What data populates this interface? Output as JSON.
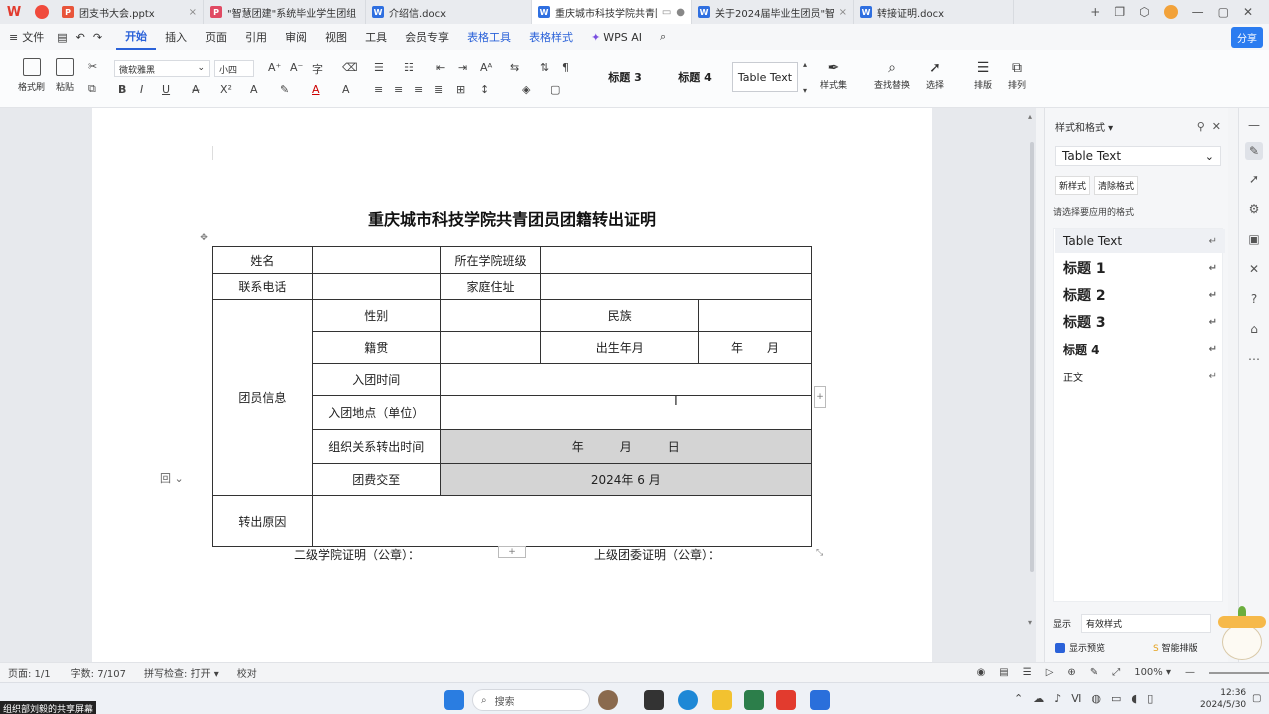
{
  "tabbar": {
    "tabs": [
      {
        "label": "团支书大会.pptx",
        "type": "P",
        "active": false
      },
      {
        "label": "\"智慧团建\"系统毕业学生团组",
        "type": "R",
        "active": false
      },
      {
        "label": "介绍信.docx",
        "type": "W",
        "active": false
      },
      {
        "label": "重庆城市科技学院共青团",
        "type": "W",
        "active": true
      },
      {
        "label": "关于2024届毕业生团员\"智",
        "type": "W",
        "active": false
      },
      {
        "label": "转接证明.docx",
        "type": "W",
        "active": false
      }
    ],
    "new_tab": "+"
  },
  "menubar": {
    "items": [
      "文件",
      "开始",
      "插入",
      "页面",
      "引用",
      "审阅",
      "视图",
      "工具",
      "会员专享",
      "表格工具",
      "表格样式",
      "WPS AI"
    ],
    "active": "开始",
    "share": "分享"
  },
  "ribbon": {
    "format_painter": "格式刷",
    "paste": "粘贴",
    "font_name": "微软雅黑",
    "font_size": "小四",
    "styles": [
      "标题 3",
      "标题 4",
      "Table Text"
    ],
    "style_set": "样式集",
    "find_replace": "查找替换",
    "select": "选择",
    "typeset": "排版",
    "arrange": "排列"
  },
  "document": {
    "title": "重庆城市科技学院共青团员团籍转出证明",
    "table": {
      "r1": [
        "姓名",
        "",
        "所在学院班级",
        ""
      ],
      "r2": [
        "联系电话",
        "",
        "家庭住址",
        ""
      ],
      "group_label": "团员信息",
      "r3": [
        "性别",
        "",
        "民族",
        ""
      ],
      "r4": [
        "籍贯",
        "",
        "出生年月",
        "年　　月"
      ],
      "r5": [
        "入团时间",
        ""
      ],
      "r6": [
        "入团地点（单位）",
        ""
      ],
      "r7": [
        "组织关系转出时间",
        "年　　　月　　　日"
      ],
      "r8": [
        "团费交至",
        "2024年  6 月"
      ],
      "r9": [
        "转出原因",
        ""
      ]
    },
    "stamp_left": "二级学院证明（公章）：",
    "stamp_right": "上级团委证明（公章）："
  },
  "side_panel": {
    "title": "样式和格式",
    "current_style": "Table Text",
    "new_style": "新样式",
    "clear_format": "清除格式",
    "prompt": "请选择要应用的格式",
    "styles": [
      "Table Text",
      "标题 1",
      "标题 2",
      "标题 3",
      "标题 4",
      "正文"
    ],
    "show_label": "显示",
    "show_value": "有效样式",
    "preview_label": "显示预览",
    "smart_label": "智能排版"
  },
  "statusbar": {
    "page": "页面: 1/1",
    "words": "字数: 7/107",
    "spell": "拼写检查: 打开",
    "proof": "校对",
    "zoom": "100%"
  },
  "taskbar": {
    "search": "搜索",
    "time": "12:36",
    "date": "2024/5/30"
  },
  "share_caption": "组织部刘毅的共享屏幕",
  "colors": {
    "accent": "#2b62d9",
    "brand": "#e23b2e",
    "gray_cell": "#d4d4d4"
  }
}
